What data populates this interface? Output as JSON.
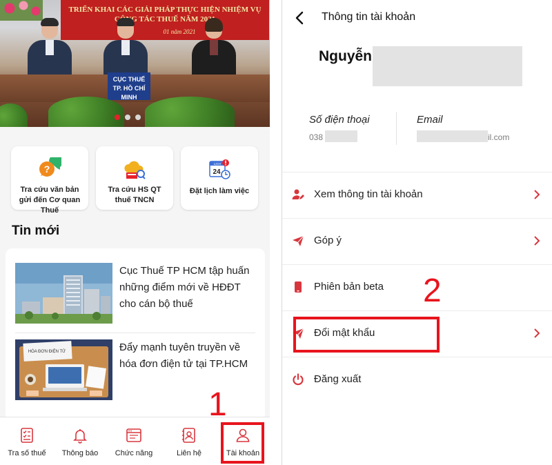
{
  "left_screen": {
    "banner": {
      "headline_line1": "TRIỂN KHAI CÁC GIẢI PHÁP THỰC HIỆN NHIỆM VỤ",
      "headline_line2": "CÔNG TÁC THUẾ NĂM 2021",
      "date_fragment": "01 năm 2021",
      "sign_line1": "CỤC THUẾ",
      "sign_line2": "TP. HỒ CHÍ MINH",
      "carousel_pages": 3,
      "carousel_active_index": 0
    },
    "quick_actions": [
      {
        "label": "Tra cứu văn bản gửi đến Cơ quan Thuế",
        "icon": "question-chat-icon"
      },
      {
        "label": "Tra cứu HS QT thuế TNCN",
        "icon": "cloud-search-icon"
      },
      {
        "label": "Đặt lịch làm việc",
        "icon": "calendar-clock-icon",
        "calendar_text": "LỊCH",
        "calendar_day": "24"
      }
    ],
    "news": {
      "section_title": "Tin mới",
      "items": [
        {
          "title": "Cục Thuế TP HCM tập huấn những điểm mới về HĐĐT cho cán bộ thuế",
          "thumb": "city-building-image"
        },
        {
          "title": "Đẩy mạnh tuyên truyền về hóa đơn điện tử tại TP.HCM",
          "thumb": "e-invoice-illustration",
          "thumb_caption": "HÓA ĐƠN ĐIỆN TỬ"
        }
      ]
    },
    "bottom_nav": [
      {
        "label": "Tra số thuế",
        "icon": "checklist-icon"
      },
      {
        "label": "Thông báo",
        "icon": "bell-icon"
      },
      {
        "label": "Chức năng",
        "icon": "window-grid-icon"
      },
      {
        "label": "Liên hệ",
        "icon": "contact-book-icon"
      },
      {
        "label": "Tài khoản",
        "icon": "user-icon"
      }
    ],
    "step_number": "1"
  },
  "right_screen": {
    "header_title": "Thông tin tài khoản",
    "user_name": "Nguyễn",
    "phone_label": "Số điện thoại",
    "phone_value": "038",
    "email_label": "Email",
    "email_value": "il.com",
    "menu": [
      {
        "label": "Xem thông tin tài khoản",
        "icon": "user-edit-icon",
        "has_chevron": true
      },
      {
        "label": "Góp ý",
        "icon": "paper-plane-icon",
        "has_chevron": true
      },
      {
        "label": "Phiên bản beta",
        "icon": "phone-icon",
        "has_chevron": false
      },
      {
        "label": "Đổi mật khẩu",
        "icon": "paper-plane-icon",
        "has_chevron": true
      },
      {
        "label": "Đăng xuất",
        "icon": "power-icon",
        "has_chevron": false
      }
    ],
    "step_number": "2"
  },
  "colors": {
    "accent_red": "#e8202a",
    "annotation_red": "#e8141d",
    "icon_red": "#d8363d",
    "background": "#f5f5f5"
  }
}
